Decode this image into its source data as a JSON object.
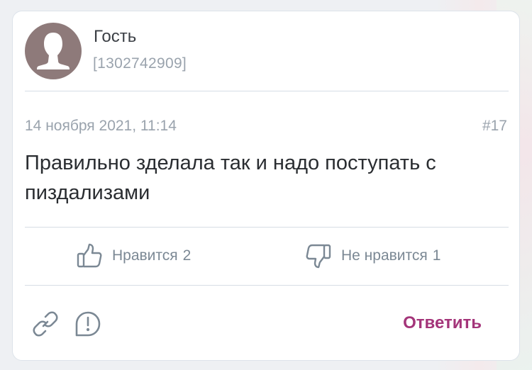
{
  "author": {
    "name": "Гость",
    "id": "[1302742909]"
  },
  "comment": {
    "date": "14 ноября 2021, 11:14",
    "number": "#17",
    "text": "Правильно зделала так и надо поступать с пиздализами"
  },
  "votes": {
    "like_label": "Нравится",
    "like_count": "2",
    "dislike_label": "Не нравится",
    "dislike_count": "1"
  },
  "actions": {
    "reply_label": "Ответить"
  },
  "icons": [
    "avatar-icon",
    "thumbs-up-icon",
    "thumbs-down-icon",
    "link-icon",
    "report-icon"
  ],
  "colors": {
    "accent": "#a4357a",
    "muted": "#9aa3ad",
    "text": "#2a2d31",
    "avatar_bg": "#8e7a7a"
  }
}
